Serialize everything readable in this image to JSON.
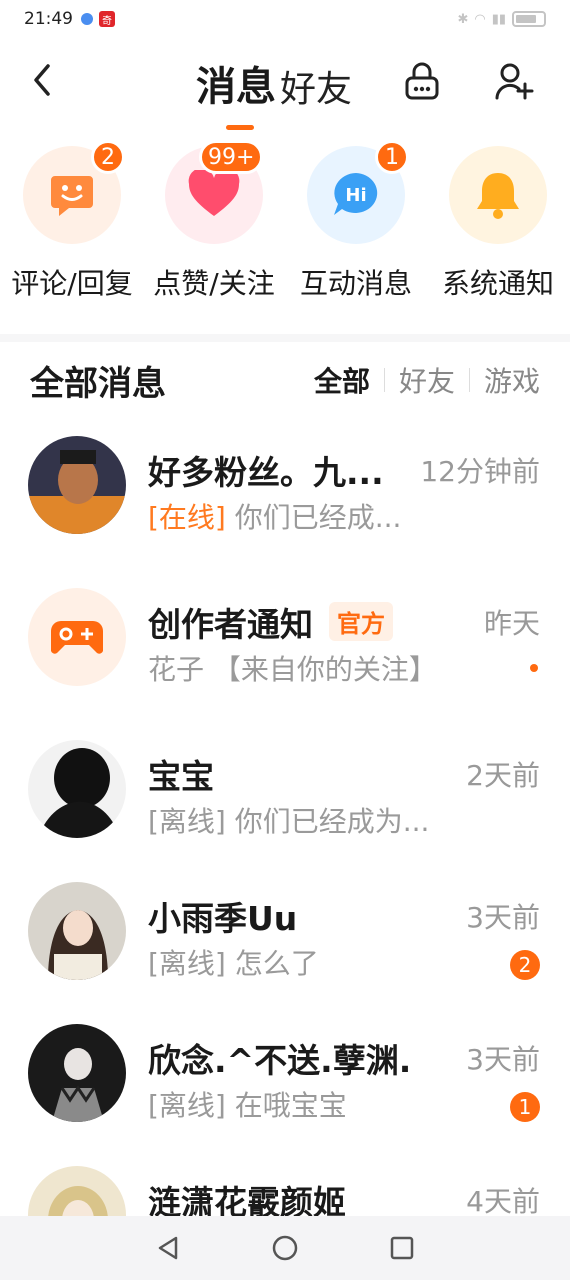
{
  "status_bar": {
    "time": "21:49",
    "app_badge": "奇"
  },
  "header": {
    "tab_messages": "消息",
    "tab_friends": "好友"
  },
  "categories": [
    {
      "label": "评论/回复",
      "badge": "2",
      "icon": "smiley-chat-icon",
      "color": "#ff8a3d",
      "bg": "#fff0e6"
    },
    {
      "label": "点赞/关注",
      "badge": "99+",
      "icon": "heart-icon",
      "color": "#ff4d6d",
      "bg": "#ffecef"
    },
    {
      "label": "互动消息",
      "badge": "1",
      "icon": "hi-chat-icon",
      "color": "#3aa0f5",
      "bg": "#e8f4ff"
    },
    {
      "label": "系统通知",
      "badge": "",
      "icon": "bell-icon",
      "color": "#ffad1f",
      "bg": "#fff4e0"
    }
  ],
  "section": {
    "title": "全部消息",
    "filters": [
      "全部",
      "好友",
      "游戏"
    ]
  },
  "messages": [
    {
      "name": "好多粉丝。九...",
      "time": "12分钟前",
      "status": "[在线]",
      "text": " 你们已经成...",
      "unread": "",
      "dot": false
    },
    {
      "name": "创作者通知",
      "official": "官方",
      "time": "昨天",
      "status": "",
      "text": "花子 【来自你的关注】",
      "unread": "",
      "dot": true
    },
    {
      "name": "宝宝",
      "time": "2天前",
      "status": "[离线]",
      "text": " 你们已经成为...",
      "unread": "",
      "dot": false
    },
    {
      "name": "小雨季Uu",
      "time": "3天前",
      "status": "[离线]",
      "text": " 怎么了",
      "unread": "2",
      "dot": false
    },
    {
      "name": "欣念.^不送.孽渊.",
      "time": "3天前",
      "status": "[离线]",
      "text": " 在哦宝宝",
      "unread": "1",
      "dot": false
    },
    {
      "name": "涟潇花霰颜姬",
      "time": "4天前",
      "status": "",
      "text": "",
      "unread": "",
      "dot": false
    }
  ]
}
